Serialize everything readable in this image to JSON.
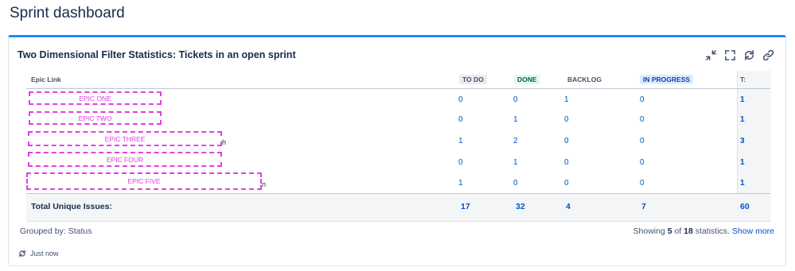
{
  "page": {
    "title": "Sprint dashboard"
  },
  "gadget": {
    "title": "Two Dimensional Filter Statistics: Tickets in an open sprint",
    "actions": [
      "minimize-icon",
      "fullscreen-icon",
      "refresh-icon",
      "link-icon"
    ],
    "accent_color": "#2684ff"
  },
  "table": {
    "header": {
      "epic_link": "Epic Link",
      "todo": "TO DO",
      "done": "DONE",
      "backlog": "BACKLOG",
      "in_progress": "IN PROGRESS",
      "total": "T:"
    },
    "rows": [
      {
        "epic": "EPIC ONE",
        "trail": "",
        "todo": "0",
        "done": "0",
        "backlog": "1",
        "in_progress": "0",
        "total": "1"
      },
      {
        "epic": "EPIC TWO",
        "trail": "",
        "todo": "0",
        "done": "1",
        "backlog": "0",
        "in_progress": "0",
        "total": "1"
      },
      {
        "epic": "EPIC THREE",
        "trail": "h",
        "todo": "1",
        "done": "2",
        "backlog": "0",
        "in_progress": "0",
        "total": "3"
      },
      {
        "epic": "EPIC FOUR",
        "trail": "",
        "todo": "0",
        "done": "1",
        "backlog": "0",
        "in_progress": "0",
        "total": "1"
      },
      {
        "epic": "EPIC FIVE",
        "trail": "n",
        "todo": "1",
        "done": "0",
        "backlog": "0",
        "in_progress": "0",
        "total": "1"
      }
    ],
    "totals": {
      "label": "Total Unique Issues:",
      "todo": "17",
      "done": "32",
      "backlog": "4",
      "in_progress": "7",
      "total": "60"
    }
  },
  "footer": {
    "grouped_by": "Grouped by: Status",
    "showing_prefix": "Showing",
    "showing_count": "5",
    "showing_of": "of",
    "showing_total": "18",
    "showing_suffix": "statistics.",
    "show_more": "Show more",
    "refreshed": "Just now"
  }
}
